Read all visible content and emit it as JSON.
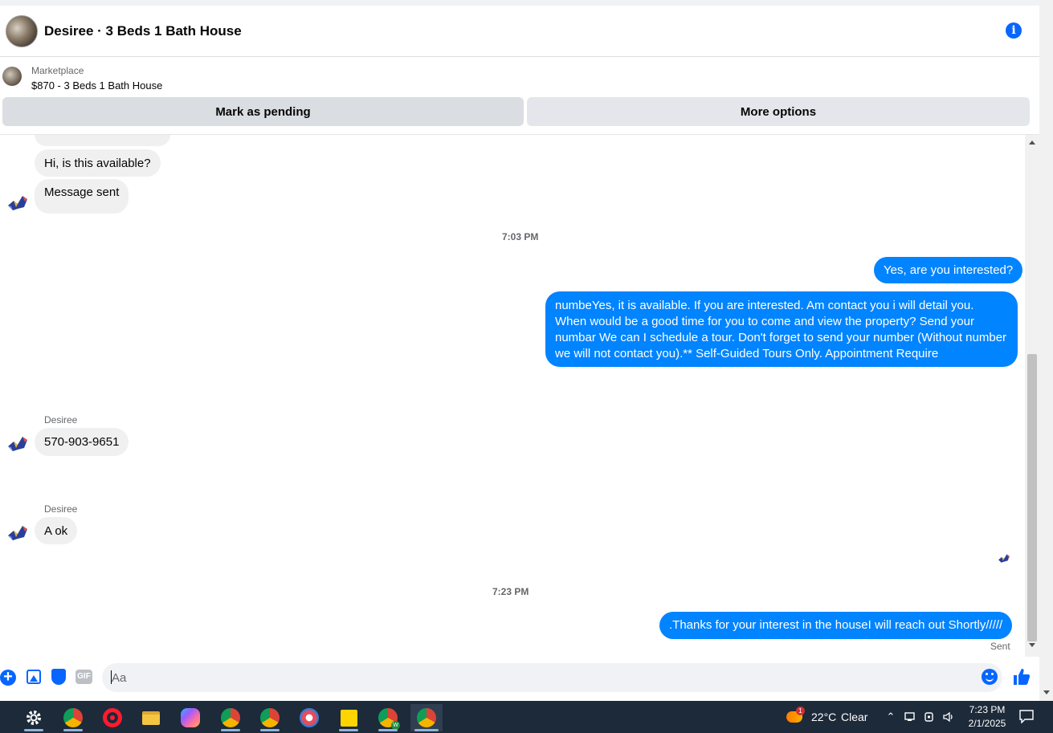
{
  "header": {
    "title": "Desiree · 3 Beds 1 Bath House",
    "info_glyph": "i"
  },
  "marketplace": {
    "label": "Marketplace",
    "listing": "$870 - 3 Beds 1 Bath House",
    "mark_pending_label": "Mark as pending",
    "more_options_label": "More options"
  },
  "messages": {
    "incoming_1": "Hi, is this available?",
    "incoming_2": "Message sent",
    "time_1": "7:03 PM",
    "outgoing_1": "Yes, are you interested?",
    "outgoing_2": "numbeYes, it is available. If you are interested.  Am contact you i will detail you. When would be a good time for you to come and view the property? Send your numbar We can I schedule a tour.  Don't forget to send your number (Without number we will not contact you).** Self-Guided Tours Only. Appointment Require",
    "sender_1": "Desiree",
    "incoming_3": "570-903-9651",
    "sender_2": "Desiree",
    "incoming_4": "A ok",
    "time_2": "7:23 PM",
    "outgoing_3": ".Thanks for your interest in the houseI will reach out Shortly/////",
    "status": "Sent"
  },
  "composer": {
    "placeholder": "Aa",
    "gif_label": "GIF"
  },
  "taskbar": {
    "weather_badge": "1",
    "temperature": "22°C",
    "condition": "Clear",
    "time": "7:23 PM",
    "date": "2/1/2025",
    "chrome_badge": "W"
  },
  "colors": {
    "accent": "#0866ff",
    "outgoing_bubble": "#0084ff",
    "incoming_bubble": "#f0f0f0",
    "taskbar": "#1c2a3a"
  }
}
